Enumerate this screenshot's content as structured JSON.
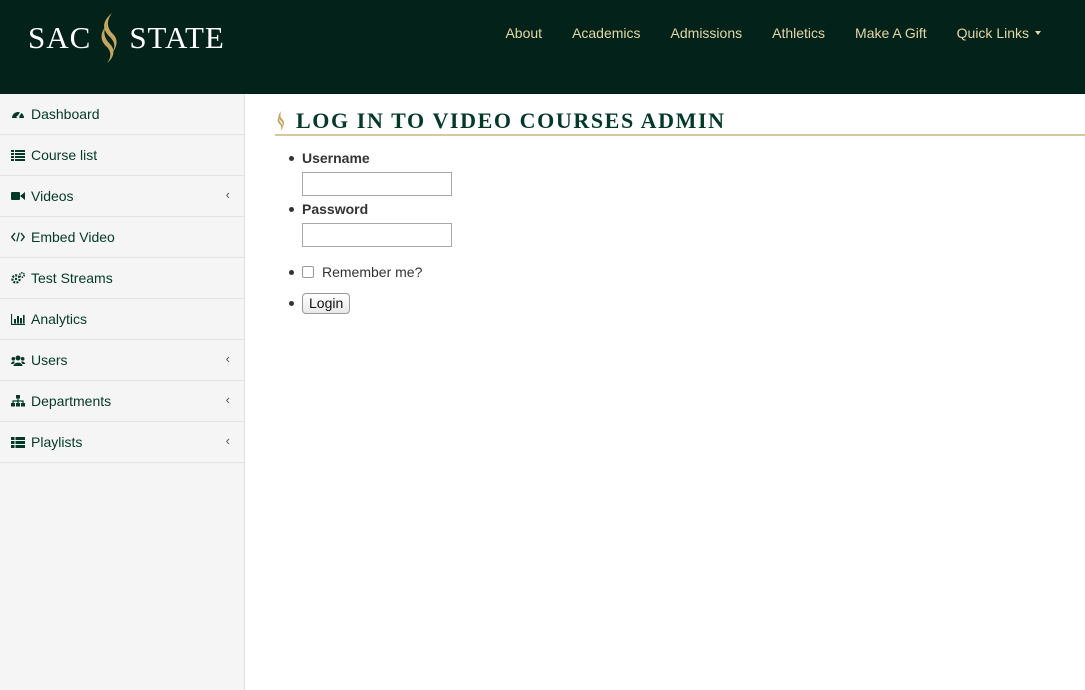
{
  "brand": {
    "logo_text_left": "SAC",
    "logo_text_right": "STATE",
    "colors": {
      "header_bg": "#032219",
      "nav_text": "#e4d6a6",
      "accent_green": "#043927",
      "gold": "#c4a661"
    }
  },
  "topnav": {
    "items": [
      {
        "label": "About"
      },
      {
        "label": "Academics"
      },
      {
        "label": "Admissions"
      },
      {
        "label": "Athletics"
      },
      {
        "label": "Make A Gift"
      },
      {
        "label": "Quick Links",
        "dropdown": true
      }
    ]
  },
  "sidebar": {
    "items": [
      {
        "label": "Dashboard",
        "icon": "tachometer-icon"
      },
      {
        "label": "Course list",
        "icon": "list-icon"
      },
      {
        "label": "Videos",
        "icon": "video-camera-icon",
        "expandable": true
      },
      {
        "label": "Embed Video",
        "icon": "code-icon"
      },
      {
        "label": "Test Streams",
        "icon": "cogs-icon"
      },
      {
        "label": "Analytics",
        "icon": "bar-chart-icon"
      },
      {
        "label": "Users",
        "icon": "users-icon",
        "expandable": true
      },
      {
        "label": "Departments",
        "icon": "sitemap-icon",
        "expandable": true
      },
      {
        "label": "Playlists",
        "icon": "th-list-icon",
        "expandable": true
      }
    ],
    "chevron": "‹"
  },
  "main": {
    "title": "Log in to Video Courses Admin",
    "form": {
      "username_label": "Username",
      "username_value": "",
      "password_label": "Password",
      "password_value": "",
      "remember_label": "Remember me?",
      "remember_checked": false,
      "login_label": "Login"
    }
  }
}
